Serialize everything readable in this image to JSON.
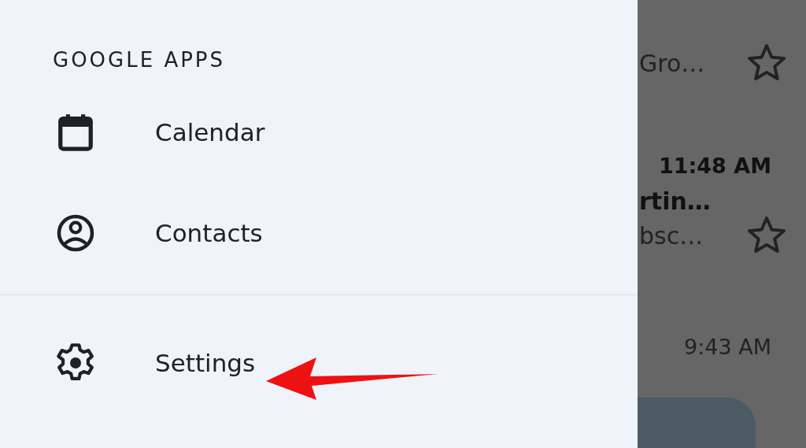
{
  "drawer": {
    "section_title": "GOOGLE APPS",
    "app_items": [
      {
        "kind": "calendar",
        "label": "Calendar"
      },
      {
        "kind": "contacts",
        "label": "Contacts"
      }
    ],
    "footer_items": [
      {
        "kind": "settings",
        "label": "Settings"
      }
    ]
  },
  "email_list": [
    {
      "subject": "Gro…",
      "starred": false
    },
    {
      "time": "11:48 AM",
      "unread": true,
      "sender": "rtin…",
      "snippet": "bsc…",
      "starred": false
    },
    {
      "time": "9:43 AM",
      "unread": false
    }
  ],
  "annotations": [
    {
      "kind": "arrow"
    }
  ]
}
